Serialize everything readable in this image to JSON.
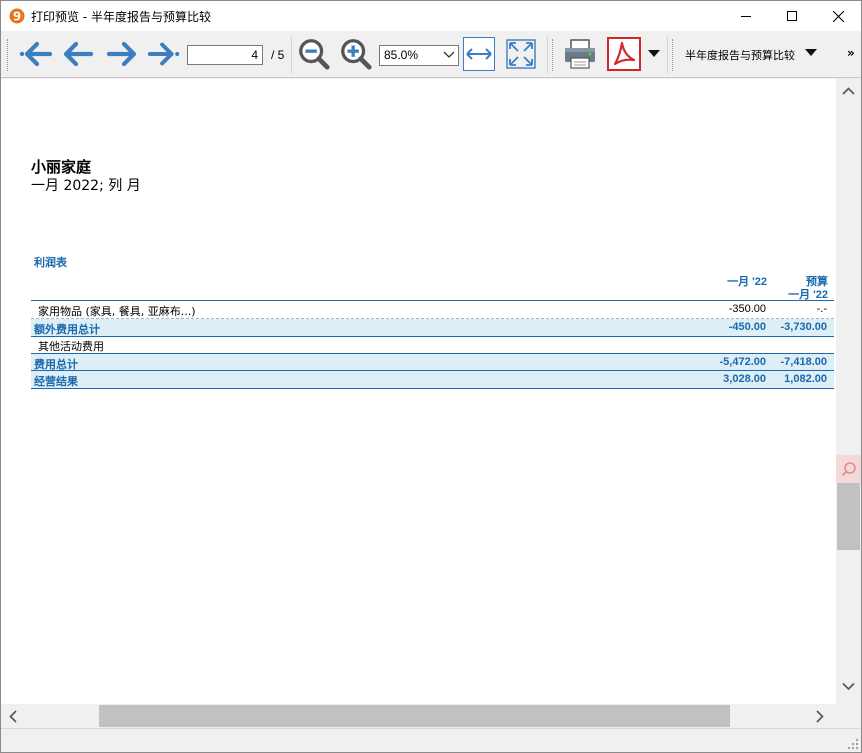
{
  "window": {
    "title": "打印预览 - 半年度报告与预算比较"
  },
  "toolbar": {
    "page_current": "4",
    "page_total": "/ 5",
    "zoom": "85.0%",
    "report_selector": "半年度报告与预算比较",
    "more": "»"
  },
  "report": {
    "title": "小丽家庭",
    "subtitle": "一月 2022; 列 月",
    "section_title": "利润表",
    "columns": {
      "actual": "一月 '22",
      "budget_line1": "预算",
      "budget_line2": "一月 '22"
    },
    "rows": [
      {
        "label": "家用物品 (家具, 餐具, 亚麻布...)",
        "actual": "-350.00",
        "budget": "-.-",
        "type": "detail"
      },
      {
        "label": "额外费用总计",
        "actual": "-450.00",
        "budget": "-3,730.00",
        "type": "total"
      },
      {
        "label": "其他活动费用",
        "actual": "",
        "budget": "",
        "type": "detail"
      },
      {
        "label": "费用总计",
        "actual": "-5,472.00",
        "budget": "-7,418.00",
        "type": "total"
      },
      {
        "label": "经营结果",
        "actual": "3,028.00",
        "budget": "1,082.00",
        "type": "total"
      }
    ]
  },
  "colors": {
    "accent": "#1a6aad",
    "total_bg": "#ddeef6",
    "pdf_red": "#d1262b"
  }
}
